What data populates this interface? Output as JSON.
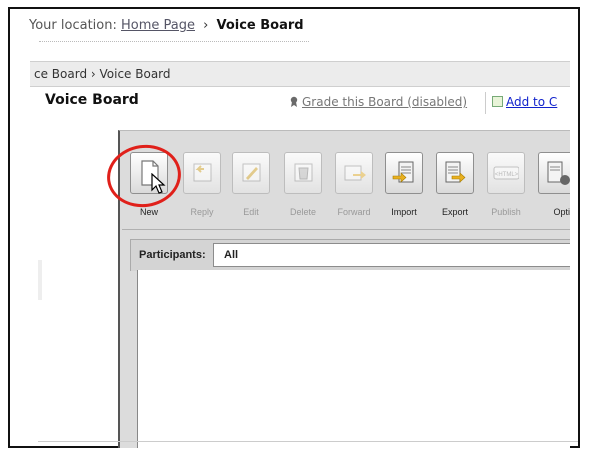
{
  "location": {
    "prefix": "Your location:",
    "home_link": "Home Page",
    "separator": "›",
    "current": "Voice Board"
  },
  "breadcrumb": {
    "text": "ce Board › Voice Board"
  },
  "board": {
    "title": "Voice Board",
    "grade_link": "Grade this Board (disabled)",
    "add_to_link": "Add to C"
  },
  "toolbar": {
    "buttons": [
      {
        "label": "New",
        "icon": "new-message-icon",
        "enabled": true
      },
      {
        "label": "Reply",
        "icon": "reply-icon",
        "enabled": false
      },
      {
        "label": "Edit",
        "icon": "edit-icon",
        "enabled": false
      },
      {
        "label": "Delete",
        "icon": "delete-icon",
        "enabled": false
      },
      {
        "label": "Forward",
        "icon": "forward-icon",
        "enabled": false
      },
      {
        "label": "Import",
        "icon": "import-icon",
        "enabled": true
      },
      {
        "label": "Export",
        "icon": "export-icon",
        "enabled": true
      },
      {
        "label": "Publish",
        "icon": "html-publish-icon",
        "enabled": false
      },
      {
        "label": "Opti",
        "icon": "options-icon",
        "enabled": true
      }
    ]
  },
  "participants": {
    "label": "Participants:",
    "selected": "All"
  },
  "colors": {
    "highlight": "#e0201a",
    "link": "#1122cc",
    "panel": "#dcdcdc"
  }
}
